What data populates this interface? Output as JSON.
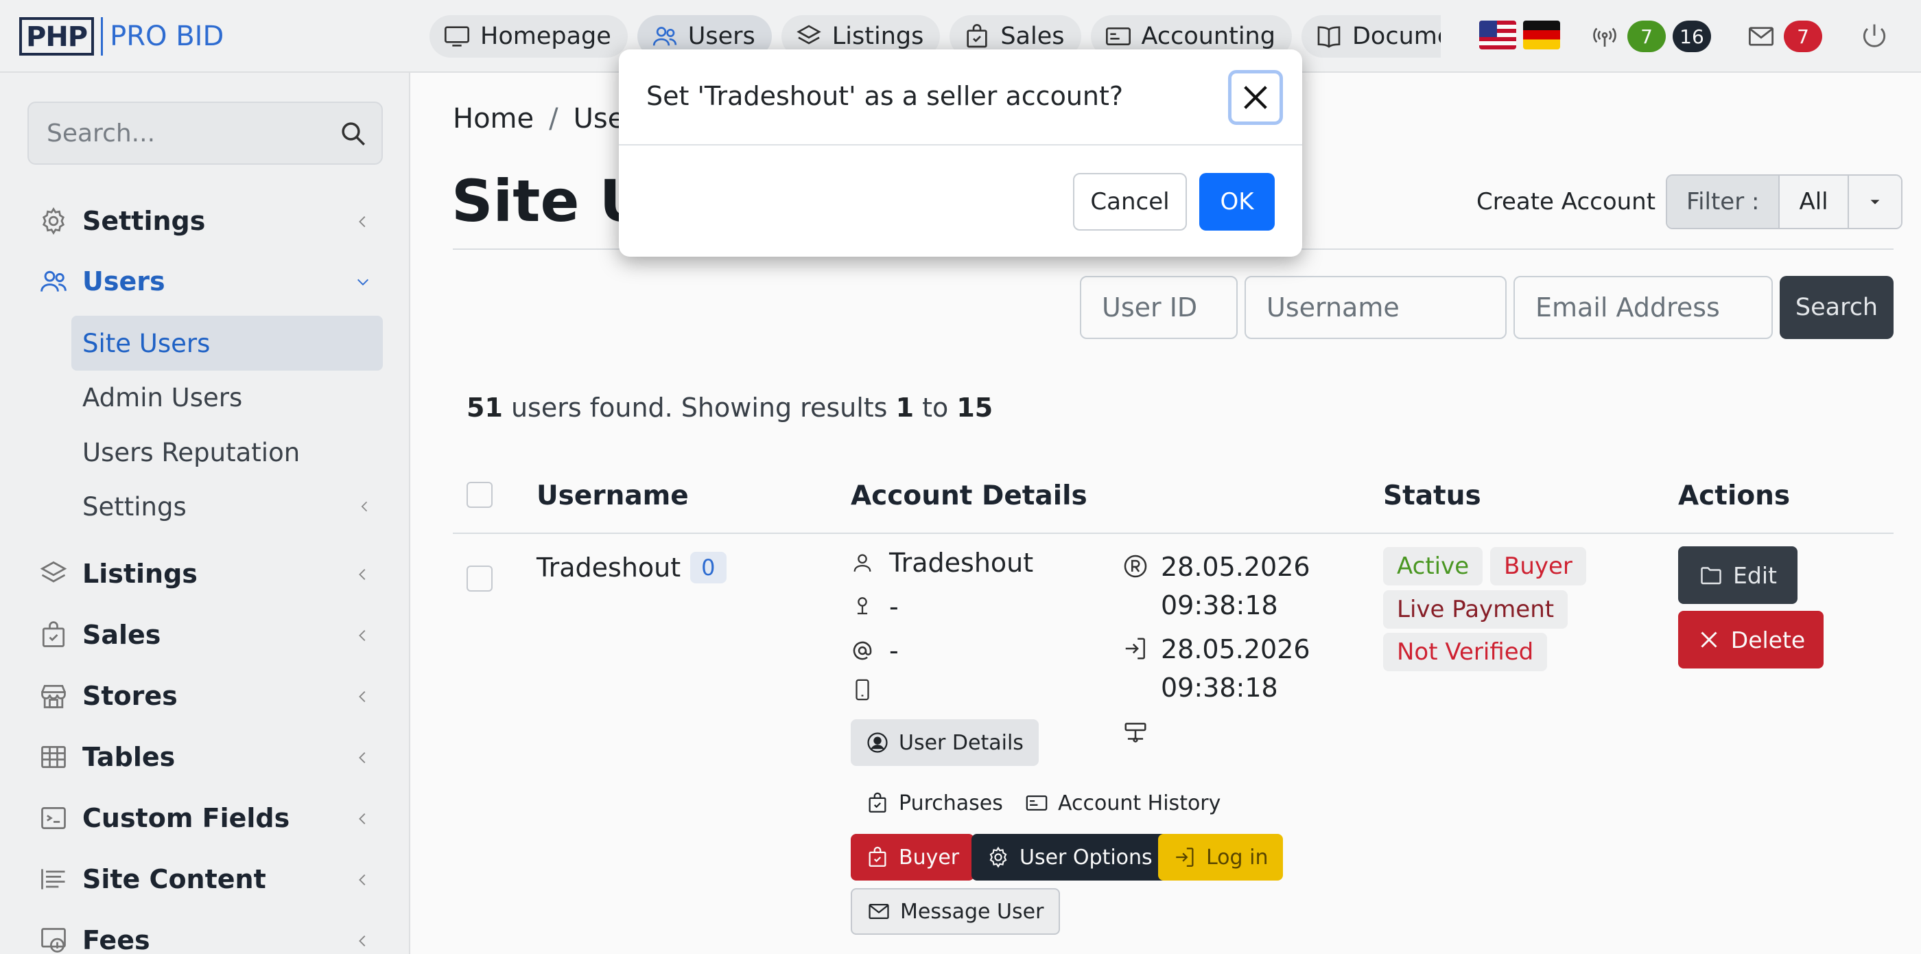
{
  "header": {
    "logo_box": "PHP",
    "logo_text": "PRO BID",
    "nav": [
      {
        "label": "Homepage"
      },
      {
        "label": "Users"
      },
      {
        "label": "Listings"
      },
      {
        "label": "Sales"
      },
      {
        "label": "Accounting"
      },
      {
        "label": "Documentation"
      }
    ],
    "badges": {
      "green": "7",
      "dark": "16",
      "messages": "7"
    }
  },
  "sidebar": {
    "search_placeholder": "Search...",
    "items": {
      "settings": "Settings",
      "users": "Users",
      "listings": "Listings",
      "sales": "Sales",
      "stores": "Stores",
      "tables": "Tables",
      "custom_fields": "Custom Fields",
      "site_content": "Site Content",
      "fees": "Fees"
    },
    "users_sub": {
      "site_users": "Site Users",
      "admin_users": "Admin Users",
      "users_reputation": "Users Reputation",
      "settings": "Settings"
    }
  },
  "main": {
    "breadcrumb": {
      "home": "Home",
      "sep": "/",
      "current": "Users"
    },
    "title": "Site Users",
    "create_account": "Create Account",
    "filter": {
      "label": "Filter :",
      "value": "All"
    },
    "search": {
      "user_id_placeholder": "User ID",
      "username_placeholder": "Username",
      "email_placeholder": "Email Address",
      "button": "Search"
    },
    "results": {
      "total": "51",
      "text1": " users found. Showing results ",
      "from": "1",
      "to_word": " to ",
      "to": "15"
    },
    "columns": {
      "username": "Username",
      "details": "Account Details",
      "status": "Status",
      "actions": "Actions"
    },
    "row": {
      "username": "Tradeshout",
      "count": "0",
      "name": "Tradeshout",
      "location": "-",
      "email": "-",
      "phone": "",
      "reg_date": "28.05.2026",
      "reg_time": "09:38:18",
      "login_date": "28.05.2026",
      "login_time": "09:38:18",
      "user_details": "User Details",
      "purchases": "Purchases",
      "account_history": "Account History",
      "buyer_btn": "Buyer",
      "user_options": "User Options",
      "log_in": "Log in",
      "message_user": "Message User",
      "status": {
        "active": "Active",
        "buyer": "Buyer",
        "live_payment": "Live Payment",
        "not_verified": "Not Verified"
      },
      "edit": "Edit",
      "delete": "Delete"
    }
  },
  "modal": {
    "title": "Set 'Tradeshout' as a seller account?",
    "cancel": "Cancel",
    "ok": "OK"
  }
}
